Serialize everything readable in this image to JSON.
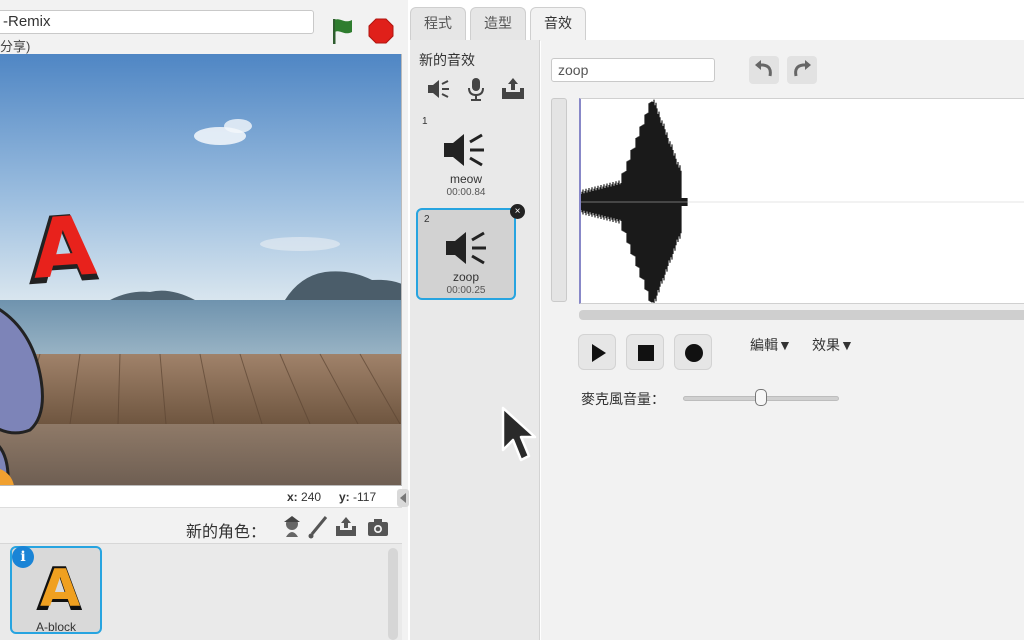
{
  "project": {
    "title": "-Remix",
    "subtitle": "分享)"
  },
  "stage": {
    "x_label": "x:",
    "x_value": "240",
    "y_label": "y:",
    "y_value": "-117",
    "overlay_letter": "A"
  },
  "sprites": {
    "new_sprite_label": "新的角色：",
    "items": [
      {
        "name": "A-block",
        "glyph": "A"
      }
    ],
    "info_label": "i"
  },
  "tabs": {
    "scripts": "程式",
    "costumes": "造型",
    "sounds": "音效"
  },
  "sounds": {
    "new_sound_label": "新的音效",
    "items": [
      {
        "index": "1",
        "name": "meow",
        "duration": "00:00.84"
      },
      {
        "index": "2",
        "name": "zoop",
        "duration": "00:00.25"
      }
    ],
    "delete_glyph": "×"
  },
  "editor": {
    "name_value": "zoop",
    "edit_menu": "編輯▼",
    "effects_menu": "效果▼",
    "mic_volume_label": "麥克風音量：",
    "mic_volume_level": 0.5
  },
  "colors": {
    "selection": "#27a4e0",
    "stop": "#e0201a",
    "flag": "#2f7d2f",
    "waveform": "#1a1a1a"
  }
}
